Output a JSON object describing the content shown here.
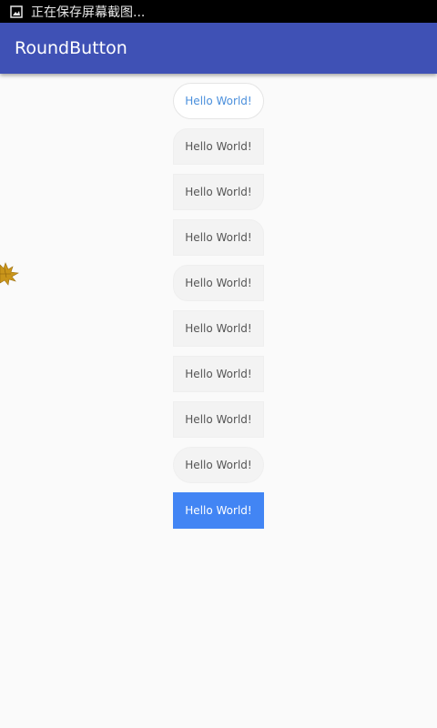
{
  "status_bar": {
    "notification_icon": "image-icon",
    "text": "正在保存屏幕截图..."
  },
  "app_bar": {
    "title": "RoundButton"
  },
  "buttons": [
    {
      "label": "Hello World!",
      "style": "outline-pill"
    },
    {
      "label": "Hello World!",
      "style": "rounded-top-left"
    },
    {
      "label": "Hello World!",
      "style": "rounded-bottom-right"
    },
    {
      "label": "Hello World!",
      "style": "rounded-top-right"
    },
    {
      "label": "Hello World!",
      "style": "rounded-left"
    },
    {
      "label": "Hello World!",
      "style": "square"
    },
    {
      "label": "Hello World!",
      "style": "square"
    },
    {
      "label": "Hello World!",
      "style": "square"
    },
    {
      "label": "Hello World!",
      "style": "pill"
    },
    {
      "label": "Hello World!",
      "style": "primary-filled"
    }
  ],
  "colors": {
    "app_bar": "#3f51b5",
    "status_bar": "#000000",
    "background": "#fafafa",
    "primary_button": "#4285f4",
    "outline_text": "#4a8fdc",
    "leaf": "#c9951a"
  },
  "decoration": {
    "icon": "maple-leaf-icon"
  }
}
